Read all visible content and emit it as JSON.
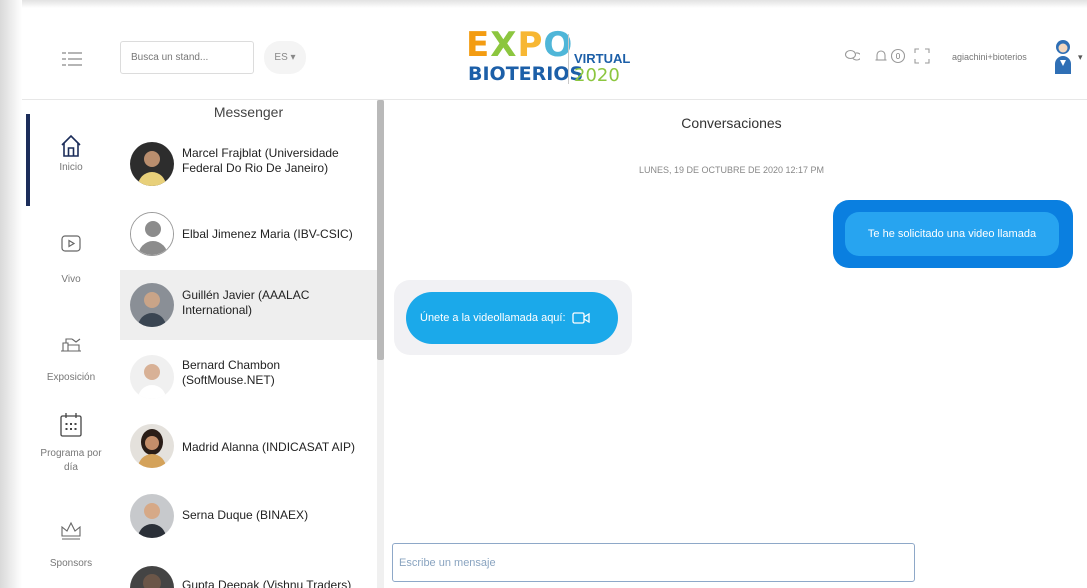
{
  "header": {
    "search_placeholder": "Busca un stand...",
    "language": "ES ▾",
    "logo": {
      "expo": [
        "E",
        "X",
        "P",
        "O"
      ],
      "bioterios": "BIOTERIOS",
      "virtual": "VIRTUAL",
      "year": "2020"
    },
    "notification_count": "0",
    "username": "agiachini+bioterios",
    "user_caret": "▾"
  },
  "nav": {
    "items": [
      {
        "label": "Inicio",
        "icon": "home-icon",
        "active": true
      },
      {
        "label": "Vivo",
        "icon": "play-icon"
      },
      {
        "label": "Exposición",
        "icon": "stand-icon"
      },
      {
        "label": "Programa por día",
        "icon": "calendar-icon"
      },
      {
        "label": "Sponsors",
        "icon": "crown-icon"
      }
    ]
  },
  "messenger": {
    "title": "Messenger",
    "contacts": [
      {
        "name": "Marcel Frajblat (Universidade Federal Do Rio De Janeiro)"
      },
      {
        "name": "Elbal Jimenez Maria (IBV-CSIC)"
      },
      {
        "name": "Guillén Javier (AAALAC International)",
        "selected": true
      },
      {
        "name": "Bernard Chambon (SoftMouse.NET)"
      },
      {
        "name": "Madrid Alanna (INDICASAT AIP)"
      },
      {
        "name": "Serna Duque (BINAEX)"
      },
      {
        "name": "Gupta Deepak (Vishnu Traders)"
      }
    ]
  },
  "conversation": {
    "title": "Conversaciones",
    "date": "LUNES, 19 DE OCTUBRE DE 2020 12:17 PM",
    "outgoing_message": "Te he solicitado una video llamada",
    "incoming_message": "Únete a la videollamada aquí:",
    "input_placeholder": "Escribe un mensaje"
  },
  "colors": {
    "accent_blue": "#0a7fe0",
    "bubble_blue": "#27a4f0",
    "nav_active": "#1c2d5a"
  }
}
